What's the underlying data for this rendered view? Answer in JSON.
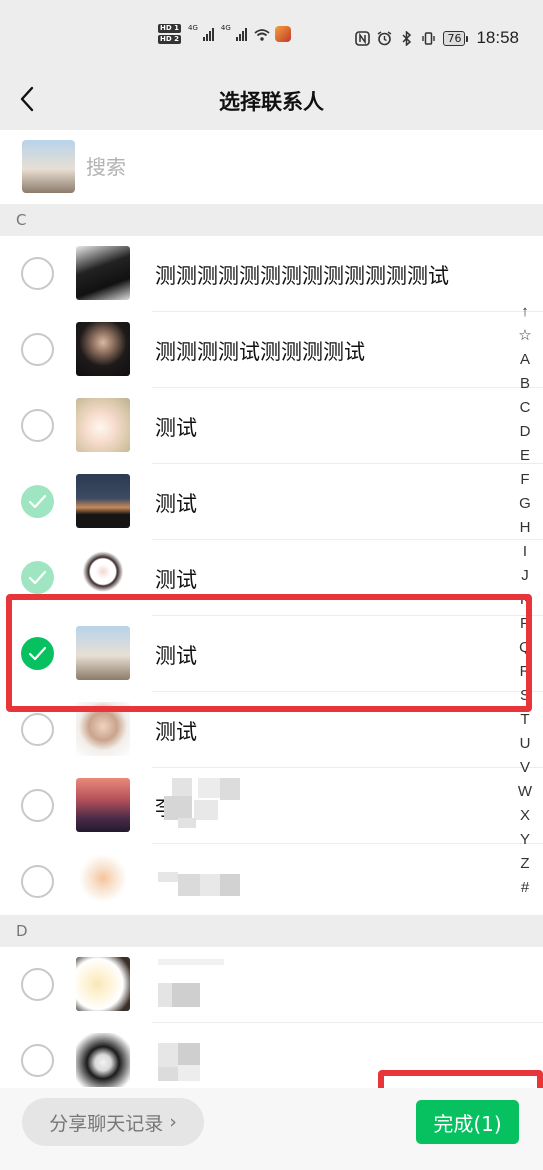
{
  "status_bar": {
    "hd1": "HD 1",
    "hd2": "HD 2",
    "sig1_label": "4G",
    "sig2_label": "4G",
    "battery": "76",
    "time": "18:58"
  },
  "nav": {
    "title": "选择联系人",
    "back_icon": "chevron-left-icon"
  },
  "search": {
    "placeholder": "搜索"
  },
  "sections": [
    {
      "letter": "C",
      "contacts": [
        {
          "name": "测测测测测测测测测测测测测试",
          "state": "unchecked"
        },
        {
          "name": "测测测测试测测测测试",
          "state": "unchecked"
        },
        {
          "name": "测试",
          "state": "unchecked"
        },
        {
          "name": "测试",
          "state": "checked-disabled"
        },
        {
          "name": "测试",
          "state": "checked-disabled"
        },
        {
          "name": "测试",
          "state": "checked"
        },
        {
          "name": "测试",
          "state": "unchecked"
        },
        {
          "name": "李",
          "state": "unchecked",
          "obscured": true
        },
        {
          "name": "",
          "state": "unchecked",
          "obscured": true
        }
      ]
    },
    {
      "letter": "D",
      "contacts": [
        {
          "name": "",
          "state": "unchecked",
          "obscured": true
        },
        {
          "name": "",
          "state": "unchecked",
          "obscured": true
        }
      ]
    }
  ],
  "index_bar": [
    "↑",
    "☆",
    "A",
    "B",
    "C",
    "D",
    "E",
    "F",
    "G",
    "H",
    "I",
    "J",
    "K",
    "P",
    "Q",
    "R",
    "S",
    "T",
    "U",
    "V",
    "W",
    "X",
    "Y",
    "Z",
    "#"
  ],
  "bottom_bar": {
    "share_label": "分享聊天记录",
    "share_chevron": "›",
    "done_label": "完成(1)"
  },
  "colors": {
    "accent": "#07c160",
    "accent_disabled": "#9fe5c1",
    "highlight": "#e8353a",
    "nav_bg": "#ededed"
  }
}
